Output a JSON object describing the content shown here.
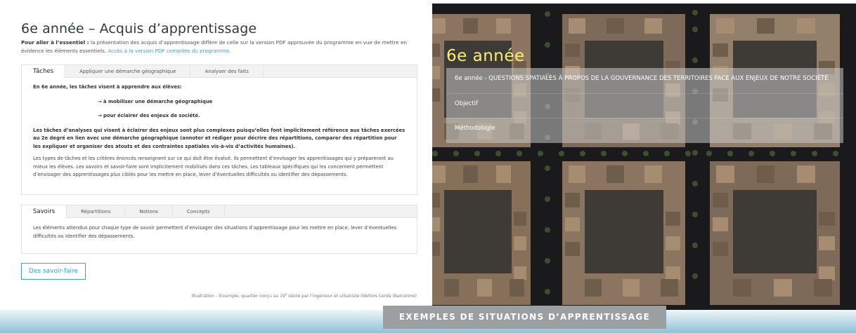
{
  "header": {
    "title": "6e année – Acquis d’apprentissage",
    "intro_bold": "Pour aller à l’essentiel :",
    "intro_text": " la présentation des acquis d’apprentissage diffère de celle sur la version PDF approuvée du programme en vue de mettre en évidence les éléments essentiels. ",
    "intro_link": "Accès à la version PDF complète du programme."
  },
  "panel1": {
    "tabs": [
      "Tâches",
      "Appliquer une démarche géographique",
      "Analyser des faits"
    ],
    "lead": "En 6e année, les tâches visent à apprendre aux élèves:",
    "point1": "→ à mobiliser une démarche géographique",
    "point2": "→ pour éclairer des enjeux de société.",
    "bold_para": "Les tâches d’analyses qui visent à éclairer des enjeux sont plus complexes puisqu’elles font implicitement référence aux tâches exercées au 2e degré en lien avec une démarche géographique (annoter et rédiger pour décrire des répartitions, comparer des répartition pour les expliquer et organiser des atouts et des contraintes spatiales vis-à-vis d’activités humaines).",
    "para": "Les types de tâches et les critères énoncés renseignent sur ce qui doit être évalué. Ils permettent d’envisager les apprentissages qui y prépareront au mieux les élèves. Les savoirs et savoir-faire sont implicitement mobilisés dans ces tâches. Les tableaux spécifiques qui les concernent permettent d’envisager des apprentissages plus ciblés pour les mettre en place, lever d’éventuelles difficultés ou identifier des dépassements."
  },
  "panel2": {
    "tabs": [
      "Savoirs",
      "Répartitions",
      "Notions",
      "Concepts"
    ],
    "para": "Les éléments attendus pour chaque type de savoir permettent d’envisager des situations d’apprentissage pour les mettre en place, lever d’éventuelles difficultés ou identifier des dépassements."
  },
  "savoir_faire_button": "Des savoir-faire",
  "caption": {
    "before": "Illustration – Eixample, quartier conçu au 19",
    "sup": "e",
    "after": " siècle par l’ingénieur et urbaniste Ildefons Cerdà (Barcelone)"
  },
  "overlay": {
    "title": "6e année",
    "items": [
      "6e année - QUESTIONS SPATIALES À PROPOS DE LA GOUVERNANCE DES TERRITOIRES FACE AUX ENJEUX DE NOTRE SOCIÉTÉ",
      "Objectif",
      "Méthodologie"
    ]
  },
  "bottom_button": "EXEMPLES DE SITUATIONS D’APPRENTISSAGE",
  "colors": {
    "accent_blue": "#3aa0d8",
    "overlay_title": "#f6ef78",
    "band_button": "#9c9fa2"
  }
}
